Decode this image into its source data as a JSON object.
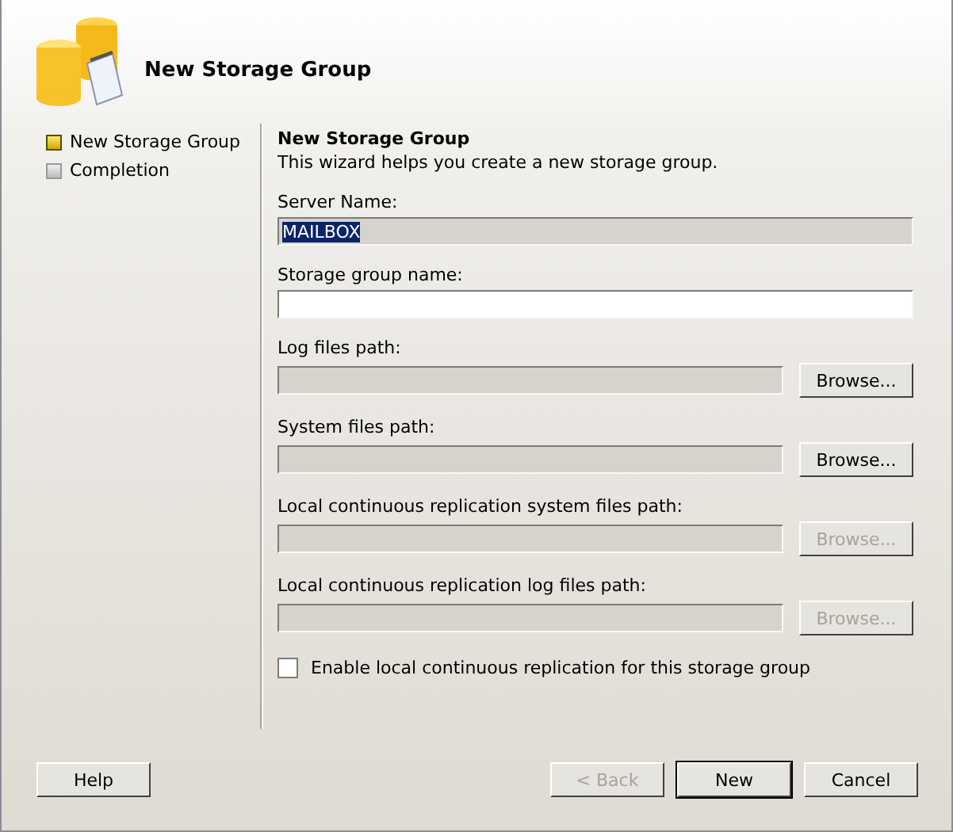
{
  "header": {
    "title": "New Storage Group"
  },
  "steps": [
    {
      "label": "New Storage Group",
      "selected": true
    },
    {
      "label": "Completion",
      "selected": false
    }
  ],
  "content": {
    "title": "New Storage Group",
    "description": "This wizard helps you create a new storage group.",
    "fields": [
      {
        "label": "Server Name:",
        "value": "MAILBOX",
        "disabled": true
      },
      {
        "label": "Storage group name:",
        "disabled": false
      },
      {
        "label": "Log files path:",
        "disabled": true,
        "browse": {
          "label": "Browse...",
          "disabled": false
        }
      },
      {
        "label": "System files path:",
        "disabled": true,
        "browse": {
          "label": "Browse...",
          "disabled": false
        }
      },
      {
        "label": "Local continuous replication system files path:",
        "disabled": true,
        "browse": {
          "label": "Browse...",
          "disabled": true
        }
      },
      {
        "label": "Local continuous replication log files path:",
        "disabled": true,
        "browse": {
          "label": "Browse...",
          "disabled": true
        }
      }
    ],
    "checkbox": {
      "label": "Enable local continuous replication for this storage group",
      "checked": false
    }
  },
  "left_buttons": [
    {
      "label": "Help",
      "disabled": false,
      "default": false
    }
  ],
  "right_buttons": [
    {
      "label": "< Back",
      "disabled": true,
      "default": false
    },
    {
      "label": "New",
      "disabled": false,
      "default": true
    },
    {
      "label": "Cancel",
      "disabled": false,
      "default": false
    }
  ]
}
